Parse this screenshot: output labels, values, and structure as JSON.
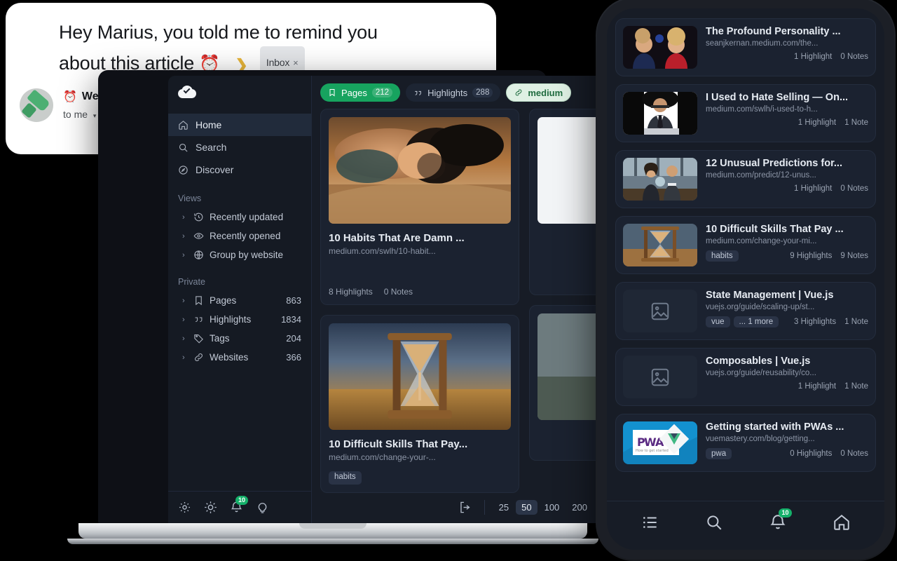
{
  "email": {
    "subject_line1": "Hey Marius, you told me to remind you",
    "subject_line2": "about this article",
    "alarm_emoji": "⏰",
    "forward_icon": "forward-chevron-icon",
    "label_chip": "Inbox",
    "label_chip_close": "×",
    "sender_name": "Web Highlights",
    "sender_alarm_emoji": "⏰",
    "recipient": "to me",
    "recipient_caret": "▾",
    "avatar_icon": "highlighter-marker-avatar"
  },
  "app": {
    "logo_icon": "cloud-check-icon",
    "sidebar": {
      "nav": [
        {
          "label": "Home",
          "icon": "home-icon",
          "active": true
        },
        {
          "label": "Search",
          "icon": "search-icon",
          "active": false
        },
        {
          "label": "Discover",
          "icon": "compass-icon",
          "active": false
        }
      ],
      "views_label": "Views",
      "views": [
        {
          "label": "Recently updated",
          "icon": "history-clock-icon"
        },
        {
          "label": "Recently opened",
          "icon": "eye-icon"
        },
        {
          "label": "Group by website",
          "icon": "globe-icon"
        }
      ],
      "private_label": "Private",
      "private": [
        {
          "label": "Pages",
          "icon": "bookmark-icon",
          "count": "863"
        },
        {
          "label": "Highlights",
          "icon": "quote-icon",
          "count": "1834"
        },
        {
          "label": "Tags",
          "icon": "tag-icon",
          "count": "204"
        },
        {
          "label": "Websites",
          "icon": "link-icon",
          "count": "366"
        }
      ],
      "caret": "›",
      "bottom_icons": [
        {
          "name": "settings-gear-icon"
        },
        {
          "name": "theme-brightness-icon"
        },
        {
          "name": "notifications-bell-icon",
          "badge": "10"
        },
        {
          "name": "lightbulb-tips-icon"
        }
      ]
    },
    "filters": [
      {
        "label": "Pages",
        "count": "212",
        "icon": "bookmark-icon",
        "style": "primary"
      },
      {
        "label": "Highlights",
        "count": "288",
        "icon": "quote-icon",
        "style": "dark"
      },
      {
        "label": "medium",
        "icon": "link-icon",
        "style": "chip-light"
      }
    ],
    "cards": [
      {
        "title": "10 Habits That Are Damn ...",
        "url": "medium.com/swlh/10-habit...",
        "tags": [],
        "highlights": "8 Highlights",
        "notes": "0 Notes",
        "thumb": "woman-lying-on-sand-beach"
      },
      {
        "title": "10 Difficult Skills That Pay...",
        "url": "medium.com/change-your-...",
        "tags": [
          "habits"
        ],
        "highlights": "",
        "notes": "",
        "thumb": "hourglass-on-table"
      }
    ],
    "footer": {
      "logout_icon": "logout-icon",
      "page_sizes": [
        "25",
        "50",
        "100",
        "200"
      ],
      "page_size_selected": "50"
    }
  },
  "phone": {
    "items": [
      {
        "title": "The Profound Personality ...",
        "url": "seanjkernan.medium.com/the...",
        "tags": [],
        "highlights": "1 Highlight",
        "notes": "0 Notes",
        "thumb": "couple-at-night-party"
      },
      {
        "title": "I Used to Hate Selling — On...",
        "url": "medium.com/swlh/i-used-to-h...",
        "tags": [],
        "highlights": "1 Highlight",
        "notes": "1 Note",
        "thumb": "man-in-suit-with-laptop"
      },
      {
        "title": "12 Unusual Predictions for...",
        "url": "medium.com/predict/12-unus...",
        "tags": [],
        "highlights": "1 Highlight",
        "notes": "0 Notes",
        "thumb": "two-people-in-office"
      },
      {
        "title": "10 Difficult Skills That Pay ...",
        "url": "medium.com/change-your-mi...",
        "tags": [
          "habits"
        ],
        "highlights": "9 Highlights",
        "notes": "9 Notes",
        "thumb": "hourglass-on-table"
      },
      {
        "title": "State Management | Vue.js",
        "url": "vuejs.org/guide/scaling-up/st...",
        "tags": [
          "vue",
          "... 1 more"
        ],
        "highlights": "3 Highlights",
        "notes": "1 Note",
        "thumb": "image-placeholder-icon"
      },
      {
        "title": "Composables | Vue.js",
        "url": "vuejs.org/guide/reusability/co...",
        "tags": [],
        "highlights": "1 Highlight",
        "notes": "1 Note",
        "thumb": "image-placeholder-icon"
      },
      {
        "title": "Getting started with PWAs ...",
        "url": "vuemastery.com/blog/getting...",
        "tags": [
          "pwa"
        ],
        "highlights": "0 Highlights",
        "notes": "0 Notes",
        "thumb": "pwa-vue-banner"
      }
    ],
    "nav": [
      {
        "name": "list-icon"
      },
      {
        "name": "search-icon"
      },
      {
        "name": "notifications-bell-icon",
        "badge": "10"
      },
      {
        "name": "home-icon"
      }
    ]
  },
  "colors": {
    "accent_green": "#17a35f",
    "badge_green": "#15b06a",
    "chip_light_bg": "#dff0e4",
    "app_bg": "#171c26",
    "card_bg": "#1b2230",
    "sidebar_bg": "#151a23"
  }
}
